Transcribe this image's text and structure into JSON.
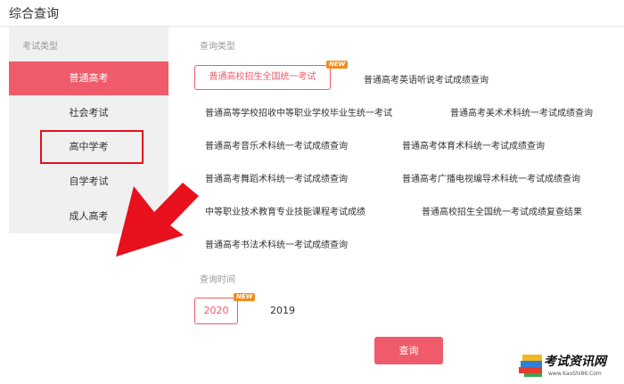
{
  "page": {
    "title": "综合查询"
  },
  "sidebar": {
    "header": "考试类型",
    "items": [
      {
        "label": "普通高考",
        "active": true
      },
      {
        "label": "社会考试",
        "active": false
      },
      {
        "label": "高中学考",
        "active": false,
        "highlighted": true
      },
      {
        "label": "自学考试",
        "active": false
      },
      {
        "label": "成人高考",
        "active": false
      }
    ]
  },
  "query_type": {
    "label": "查询类型",
    "options": [
      {
        "label": "普通高校招生全国统一考试",
        "selected": true,
        "badge": "NEW"
      },
      {
        "label": "普通高考英语听说考试成绩查询"
      },
      {
        "label": "普通高等学校招收中等职业学校毕业生统一考试"
      },
      {
        "label": "普通高考美术术科统一考试成绩查询"
      },
      {
        "label": "普通高考音乐术科统一考试成绩查询"
      },
      {
        "label": "普通高考体育术科统一考试成绩查询"
      },
      {
        "label": "普通高考舞蹈术科统一考试成绩查询"
      },
      {
        "label": "普通高考广播电视编导术科统一考试成绩查询"
      },
      {
        "label": "中等职业技术教育专业技能课程考试成绩"
      },
      {
        "label": "普通高校招生全国统一考试成绩复查结果"
      },
      {
        "label": "普通高考书法术科统一考试成绩查询"
      }
    ]
  },
  "query_time": {
    "label": "查询时间",
    "options": [
      {
        "label": "2020",
        "selected": true,
        "badge": "NEW"
      },
      {
        "label": "2019",
        "selected": false
      }
    ]
  },
  "actions": {
    "query_label": "查询"
  },
  "watermark": {
    "name": "考试资讯网",
    "url": "www.KaoShi86.Com"
  },
  "colors": {
    "accent": "#ef5b6a",
    "badge": "#f08c1c",
    "annotation": "#e4101d"
  },
  "icons": {
    "annotation_arrow": "arrow-pointer-icon",
    "watermark_logo": "books-logo-icon"
  }
}
